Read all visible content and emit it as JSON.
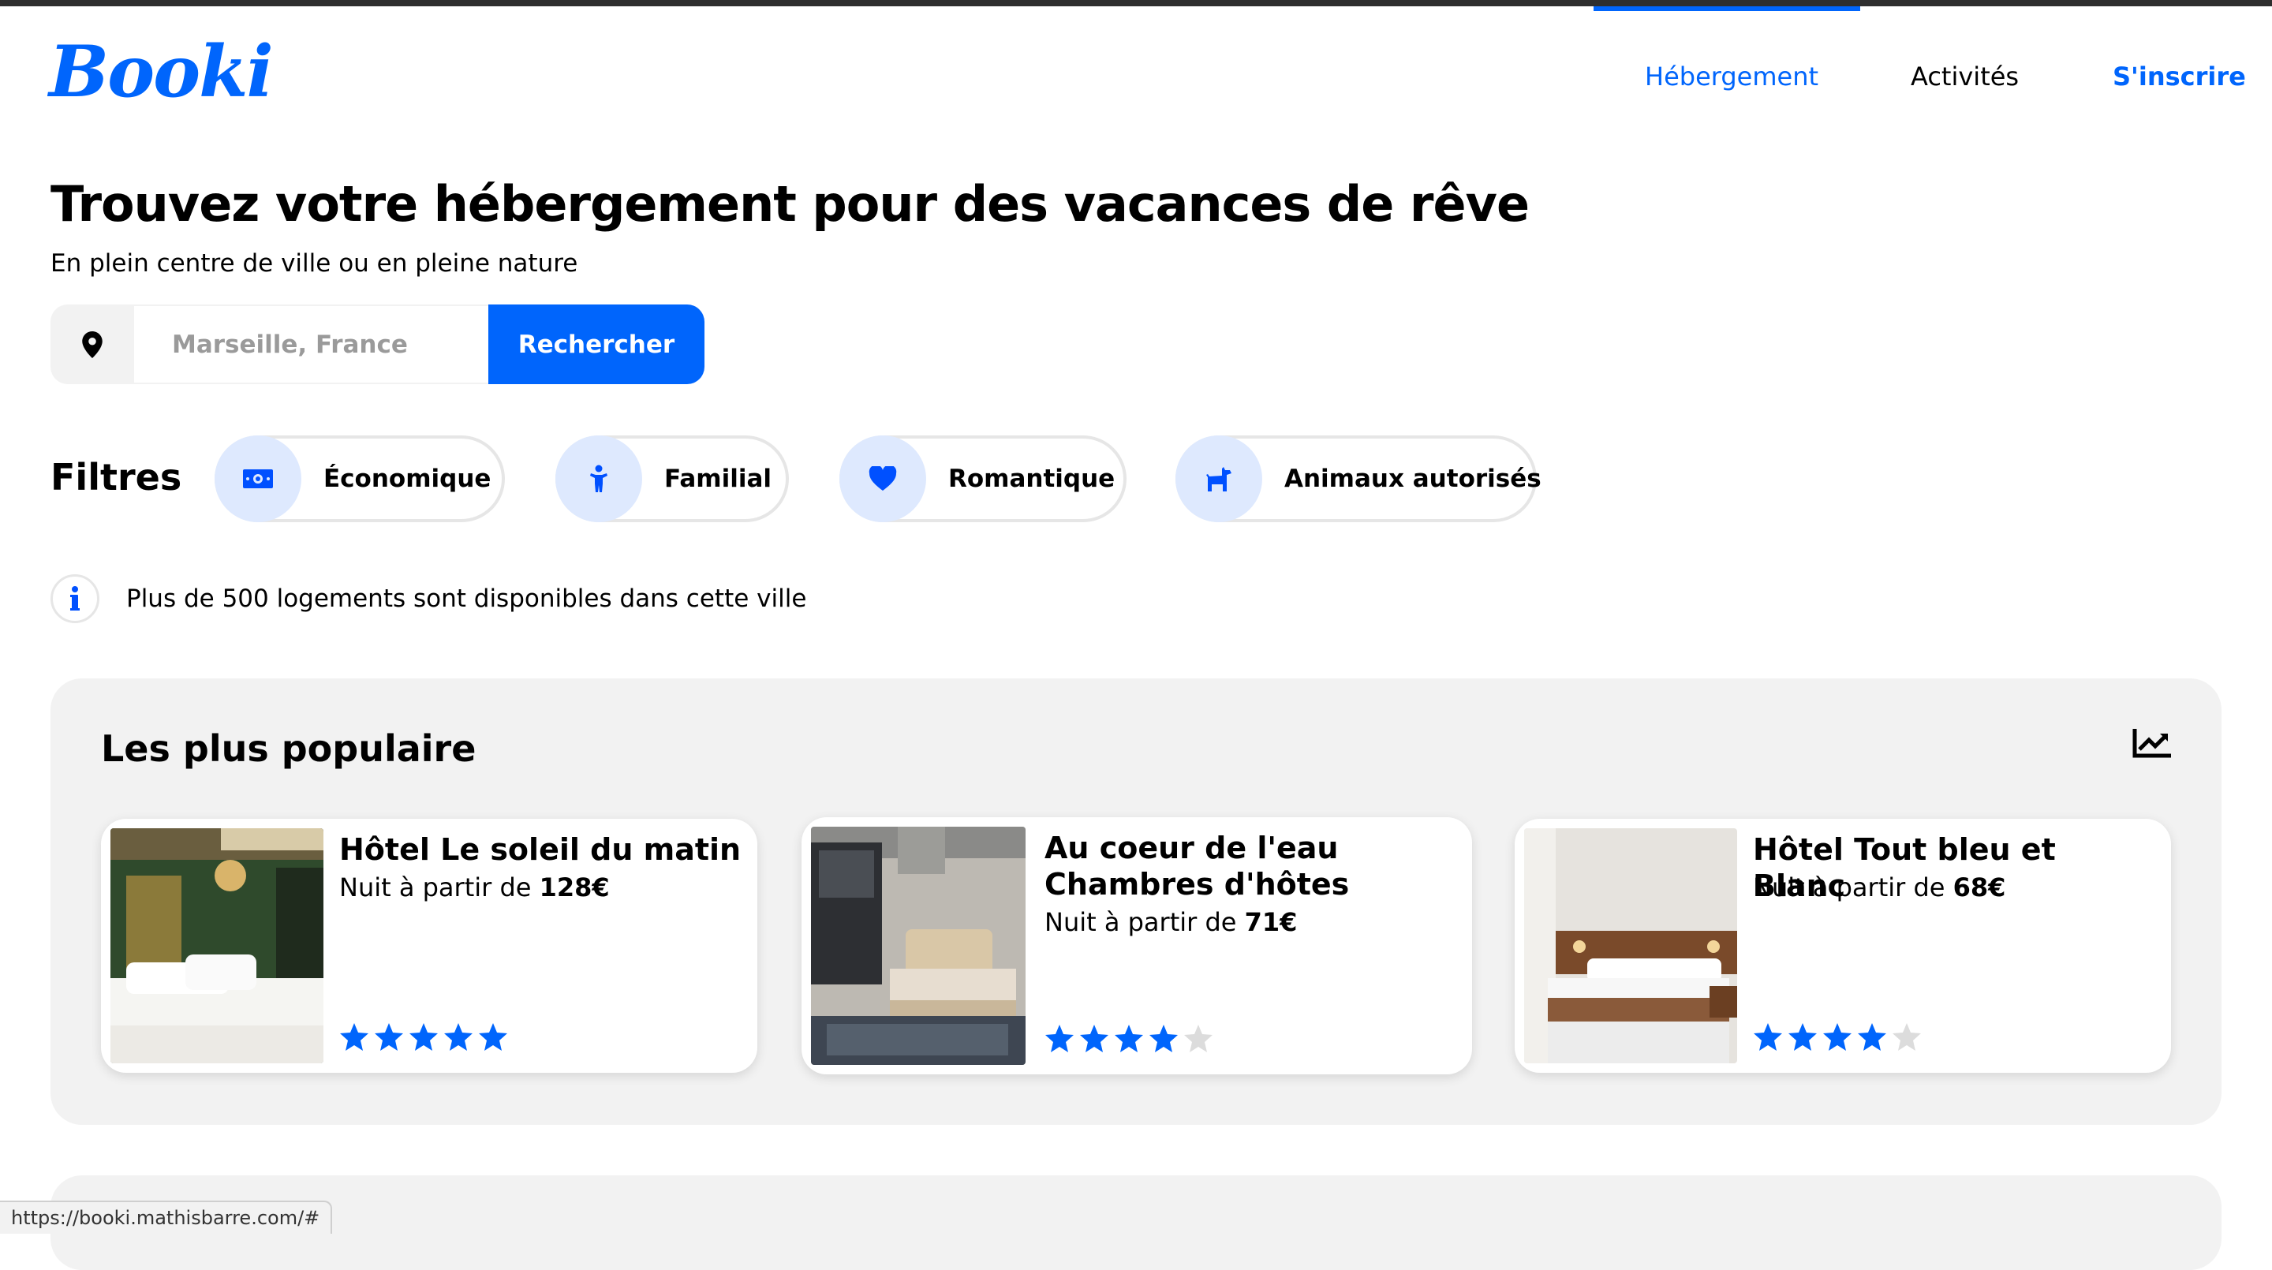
{
  "app": {
    "logo": "Booki"
  },
  "nav": {
    "items": [
      {
        "label": "Hébergement",
        "active": true
      },
      {
        "label": "Activités",
        "active": false
      },
      {
        "label": "S'inscrire",
        "active": false
      }
    ]
  },
  "hero": {
    "title": "Trouvez votre hébergement pour des vacances de rêve",
    "subtitle": "En plein centre de ville ou en pleine nature"
  },
  "search": {
    "placeholder": "Marseille, France",
    "button_label": "Rechercher",
    "icon": "location-pin-icon"
  },
  "filters": {
    "label": "Filtres",
    "chips": [
      {
        "label": "Économique",
        "icon": "money-icon"
      },
      {
        "label": "Familial",
        "icon": "child-icon"
      },
      {
        "label": "Romantique",
        "icon": "heart-icon"
      },
      {
        "label": "Animaux autorisés",
        "icon": "dog-icon"
      }
    ]
  },
  "info": {
    "text": "Plus de 500 logements sont disponibles dans cette ville",
    "icon": "info-icon"
  },
  "popular": {
    "title": "Les plus populaire",
    "icon": "trending-chart-icon",
    "cards": [
      {
        "name": "Hôtel Le soleil du matin",
        "price_prefix": "Nuit à partir de ",
        "price": "128€",
        "rating": 5
      },
      {
        "name": "Au coeur de l'eau Chambres d'hôtes",
        "price_prefix": "Nuit à partir de ",
        "price": "71€",
        "rating": 4
      },
      {
        "name": "Hôtel Tout bleu et Blanc",
        "price_prefix": "Nuit à partir de ",
        "price": "68€",
        "rating": 4
      }
    ]
  },
  "status_bar": {
    "url": "https://booki.mathisbarre.com/#"
  },
  "colors": {
    "accent": "#0065FC",
    "accent_light": "#dee9fe",
    "section_bg": "#f2f2f2",
    "star_empty": "#dcdcdc"
  }
}
